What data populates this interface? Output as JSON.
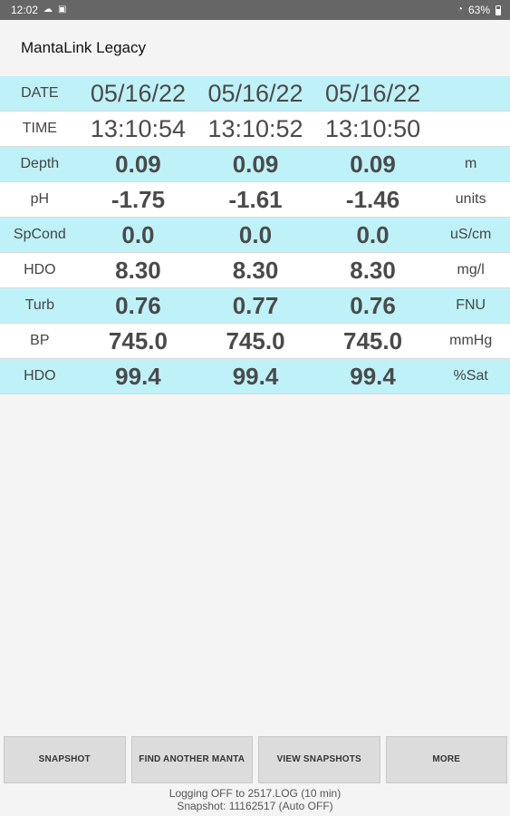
{
  "statusbar": {
    "time": "12:02",
    "battery": "63%"
  },
  "app": {
    "title": "MantaLink Legacy"
  },
  "rows": [
    {
      "label": "DATE",
      "values": [
        "05/16/22",
        "05/16/22",
        "05/16/22"
      ],
      "unit": ""
    },
    {
      "label": "TIME",
      "values": [
        "13:10:54",
        "13:10:52",
        "13:10:50"
      ],
      "unit": ""
    },
    {
      "label": "Depth",
      "values": [
        "0.09",
        "0.09",
        "0.09"
      ],
      "unit": "m"
    },
    {
      "label": "pH",
      "values": [
        "-1.75",
        "-1.61",
        "-1.46"
      ],
      "unit": "units"
    },
    {
      "label": "SpCond",
      "values": [
        "0.0",
        "0.0",
        "0.0"
      ],
      "unit": "uS/cm"
    },
    {
      "label": "HDO",
      "values": [
        "8.30",
        "8.30",
        "8.30"
      ],
      "unit": "mg/l"
    },
    {
      "label": "Turb",
      "values": [
        "0.76",
        "0.77",
        "0.76"
      ],
      "unit": "FNU"
    },
    {
      "label": "BP",
      "values": [
        "745.0",
        "745.0",
        "745.0"
      ],
      "unit": "mmHg"
    },
    {
      "label": "HDO",
      "values": [
        "99.4",
        "99.4",
        "99.4"
      ],
      "unit": "%Sat"
    }
  ],
  "buttons": {
    "snapshot": "SNAPSHOT",
    "find_another": "FIND ANOTHER MANTA",
    "view_snapshots": "VIEW SNAPSHOTS",
    "more": "MORE"
  },
  "footer": {
    "logging": "Logging OFF to 2517.LOG (10 min)",
    "snapshot": "Snapshot: 11162517 (Auto OFF)"
  },
  "colors": {
    "row_highlight": "#bff2f8",
    "statusbar": "#666666"
  }
}
